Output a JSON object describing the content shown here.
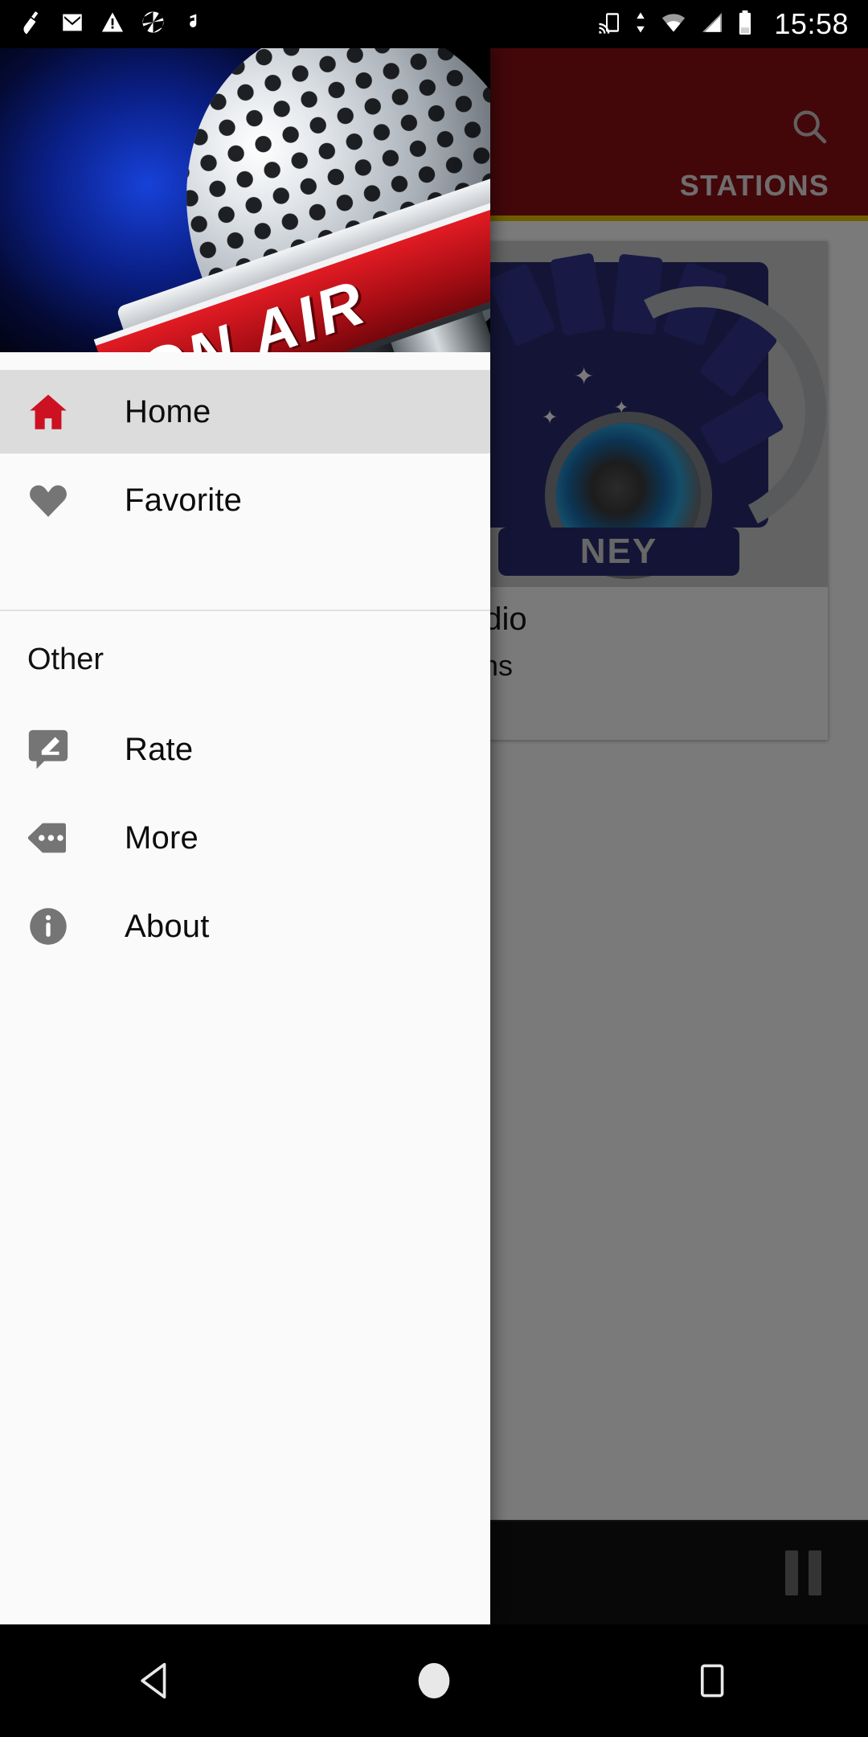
{
  "status_bar": {
    "clock": "15:58",
    "left_icons": [
      "broom-cleaner-icon",
      "gmail-icon",
      "warning-triangle-icon",
      "camera-aperture-icon",
      "music-note-icon"
    ],
    "right_icons": [
      "cast-screen-icon",
      "data-transfer-icon",
      "wifi-icon",
      "cellular-signal-icon",
      "battery-icon"
    ]
  },
  "app": {
    "app_bar": {
      "background_color": "#8C1016",
      "search_icon": "search-icon"
    },
    "tabs": [
      {
        "label": "STATIONS",
        "selected": true
      }
    ],
    "tab_indicator_color": "#E8C400",
    "station_card": {
      "logo_text": "NEY",
      "title": "adio",
      "subtitle": "ons"
    },
    "player": {
      "pause_icon": "pause-icon"
    }
  },
  "drawer": {
    "header": {
      "image_name": "on-air-microphone-banner",
      "image_text": "ON AIR"
    },
    "primary_items": [
      {
        "label": "Home",
        "icon": "home-icon",
        "icon_color": "#CC1122",
        "selected": true
      },
      {
        "label": "Favorite",
        "icon": "heart-icon",
        "icon_color": "#757575",
        "selected": false
      }
    ],
    "section": {
      "title": "Other",
      "items": [
        {
          "label": "Rate",
          "icon": "rate-review-icon",
          "icon_color": "#757575"
        },
        {
          "label": "More",
          "icon": "more-label-icon",
          "icon_color": "#757575"
        },
        {
          "label": "About",
          "icon": "info-icon",
          "icon_color": "#757575"
        }
      ]
    }
  },
  "nav_bar": {
    "back": "back-triangle-icon",
    "home": "home-circle-icon",
    "recents": "recents-square-icon"
  }
}
